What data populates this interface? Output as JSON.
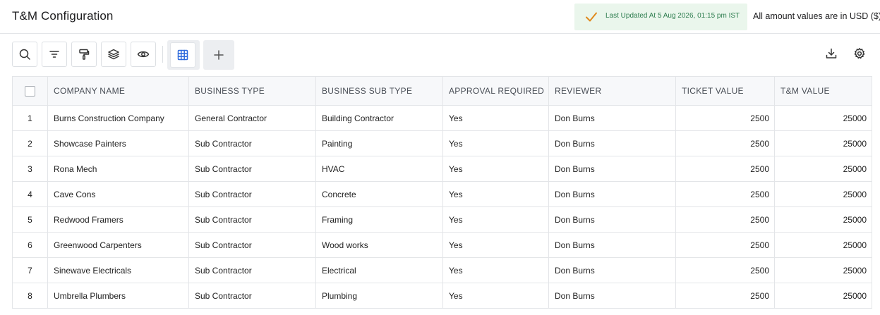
{
  "header": {
    "title": "T&M Configuration",
    "last_updated": "Last Updated At 5 Aug 2026, 01:15 pm IST",
    "currency_note": "All amount values are in USD ($)",
    "success_color": "#2e7d4f"
  },
  "toolbar": {
    "icons": [
      "search-icon",
      "filter-icon",
      "paint-roller-icon",
      "layers-icon",
      "eye-icon",
      "grid-icon",
      "plus-icon",
      "download-icon",
      "gear-icon"
    ]
  },
  "table": {
    "columns": [
      "COMPANY NAME",
      "BUSINESS TYPE",
      "BUSINESS SUB TYPE",
      "APPROVAL REQUIRED",
      "REVIEWER",
      "TICKET VALUE",
      "T&M VALUE"
    ],
    "rows": [
      [
        "1",
        "Burns Construction Company",
        "General Contractor",
        "Building Contractor",
        "Yes",
        "Don Burns",
        "2500",
        "25000"
      ],
      [
        "2",
        "Showcase Painters",
        "Sub Contractor",
        "Painting",
        "Yes",
        "Don Burns",
        "2500",
        "25000"
      ],
      [
        "3",
        "Rona Mech",
        "Sub Contractor",
        "HVAC",
        "Yes",
        "Don Burns",
        "2500",
        "25000"
      ],
      [
        "4",
        "Cave Cons",
        "Sub Contractor",
        "Concrete",
        "Yes",
        "Don Burns",
        "2500",
        "25000"
      ],
      [
        "5",
        "Redwood Framers",
        "Sub Contractor",
        "Framing",
        "Yes",
        "Don Burns",
        "2500",
        "25000"
      ],
      [
        "6",
        "Greenwood Carpenters",
        "Sub Contractor",
        "Wood works",
        "Yes",
        "Don Burns",
        "2500",
        "25000"
      ],
      [
        "7",
        "Sinewave Electricals",
        "Sub Contractor",
        "Electrical",
        "Yes",
        "Don Burns",
        "2500",
        "25000"
      ],
      [
        "8",
        "Umbrella Plumbers",
        "Sub Contractor",
        "Plumbing",
        "Yes",
        "Don Burns",
        "2500",
        "25000"
      ]
    ]
  }
}
